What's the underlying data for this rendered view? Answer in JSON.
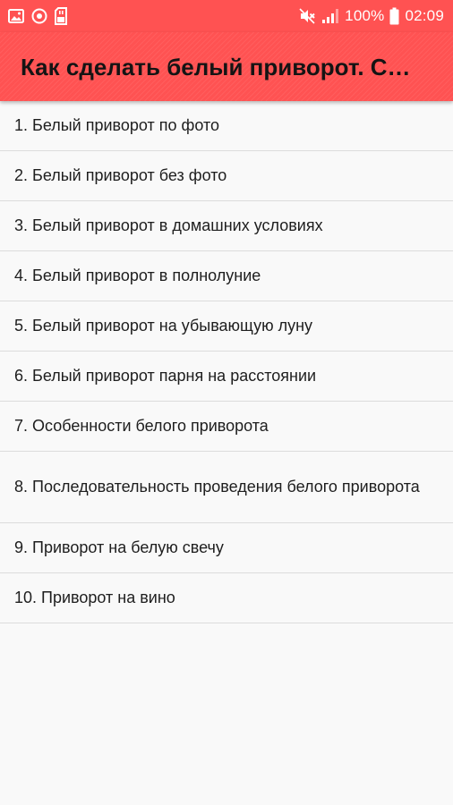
{
  "status_bar": {
    "left_icons": [
      "image-icon",
      "target-icon",
      "sd-card-icon"
    ],
    "right_icons": [
      "mute-icon",
      "signal-icon"
    ],
    "battery": "100%",
    "time": "02:09"
  },
  "app_bar": {
    "title": "Как сделать белый приворот. С…"
  },
  "list": {
    "items": [
      {
        "label": "1. Белый приворот по фото"
      },
      {
        "label": "2. Белый приворот без фото"
      },
      {
        "label": "3. Белый приворот в домашних условиях"
      },
      {
        "label": "4. Белый приворот в полнолуние"
      },
      {
        "label": "5. Белый приворот на убывающую луну"
      },
      {
        "label": "6. Белый приворот парня на расстоянии"
      },
      {
        "label": "7. Особенности белого приворота"
      },
      {
        "label": "8. Последовательность проведения белого приворота"
      },
      {
        "label": "9. Приворот на белую свечу"
      },
      {
        "label": "10. Приворот на вино"
      }
    ]
  },
  "colors": {
    "accent": "#ff5252",
    "background": "#f9f9f9",
    "divider": "#dcdcdc"
  }
}
